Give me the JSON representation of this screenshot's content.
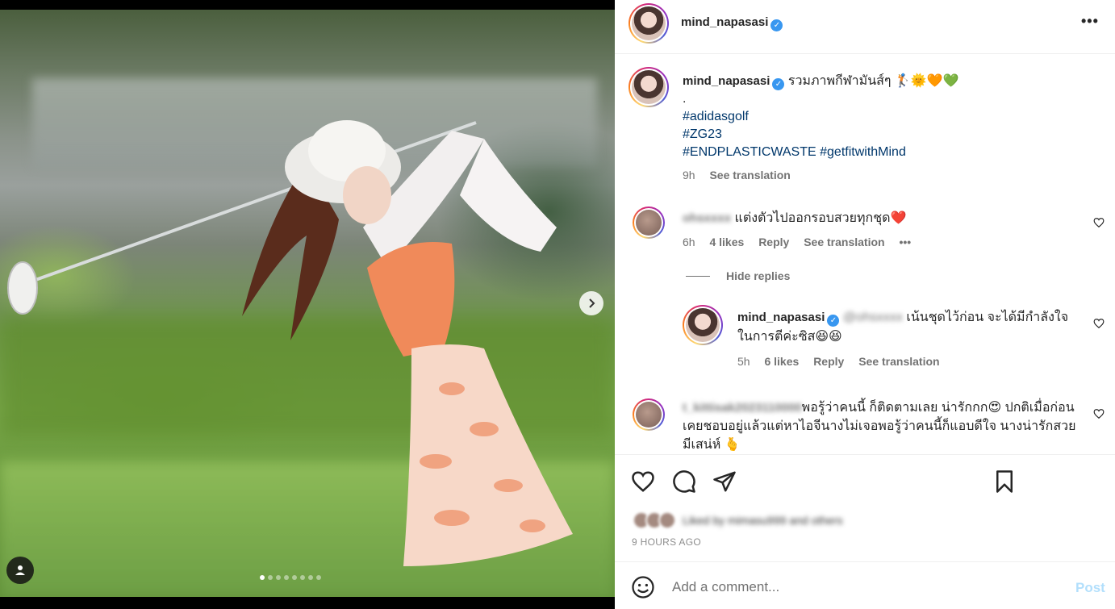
{
  "post": {
    "username": "mind_napasasi",
    "verified_mark": "✓",
    "more_label": "•••"
  },
  "caption": {
    "username": "mind_napasasi",
    "text": "รวมภาพกีฬามันส์ๆ 🏌️🌞🧡💚",
    "dot": ".",
    "hashtags": [
      "#adidasgolf",
      "#ZG23",
      "#ENDPLASTICWASTE",
      "#getfitwithMind"
    ],
    "time": "9h",
    "see_translation": "See translation"
  },
  "comments": [
    {
      "username": "ohsxxxx",
      "text": "แต่งตัวไปออกรอบสวยทุกชุด❤️",
      "time": "6h",
      "likes": "4 likes",
      "reply": "Reply",
      "see_translation": "See translation",
      "more": "•••",
      "hide_replies": "Hide replies",
      "replies": [
        {
          "username": "mind_napasasi",
          "mention": "@ohsxxxx",
          "text": "เน้นชุดไว้ก่อน จะได้มีกำลังใจในการตีค่ะซิส😆😆",
          "time": "5h",
          "likes": "6 likes",
          "reply": "Reply",
          "see_translation": "See translation"
        }
      ]
    },
    {
      "username": "t_kittisak2023110000",
      "text": "พอรู้ว่าคนนี้ ก็ติดตามเลย น่ารักกก😍 ปกติเมื่อก่อนเคยชอบอยู่แล้วแต่หาไอจีนางไม่เจอพอรู้ว่าคนนี้ก็แอบดีใจ นางน่ารักสวยมีเสน่ห์ 🫰"
    }
  ],
  "likes": {
    "text": "Liked by mimasu999 and others"
  },
  "timeago": "9 HOURS AGO",
  "add_comment": {
    "placeholder": "Add a comment...",
    "post_label": "Post"
  },
  "carousel": {
    "total": 8,
    "active": 0
  },
  "colors": {
    "link": "#00376b",
    "verified": "#3897f0",
    "post_button": "#b2dffc",
    "muted": "#737373"
  }
}
